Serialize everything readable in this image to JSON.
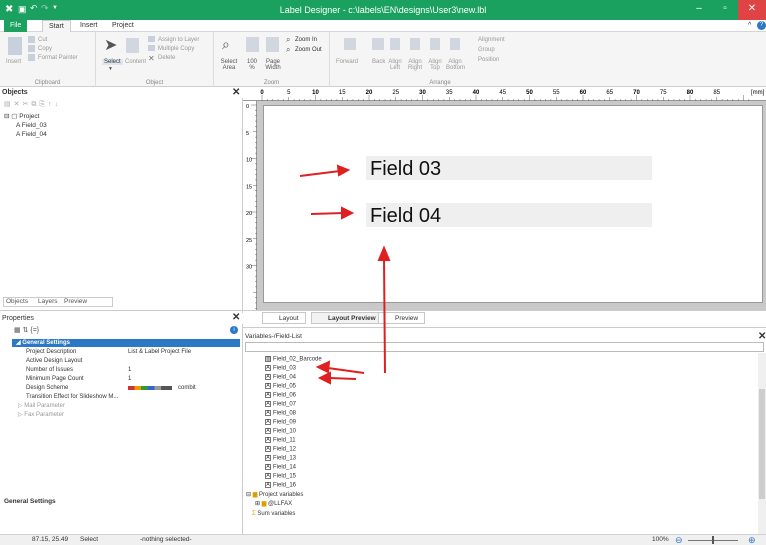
{
  "window": {
    "title": "Label Designer - c:\\labels\\EN\\designs\\User3\\new.lbl"
  },
  "tabs": [
    {
      "label": "File"
    },
    {
      "label": "Start"
    },
    {
      "label": "Insert"
    },
    {
      "label": "Project"
    }
  ],
  "ribbon": {
    "clipboard": {
      "label": "Clipboard",
      "insert": "Insert",
      "cut": "Cut",
      "copy": "Copy",
      "format_painter": "Format Painter"
    },
    "object": {
      "label": "Object",
      "select": "Select",
      "content": "Content",
      "assign_layer": "Assign to Layer",
      "multiple_copy": "Multiple Copy",
      "delete": "Delete"
    },
    "zoom": {
      "label": "Zoom",
      "select_area": "Select Area",
      "hundred": "100 %",
      "page_width": "Page Width",
      "zoom_in": "Zoom In",
      "zoom_out": "Zoom Out"
    },
    "arrange": {
      "label": "Arrange",
      "forward": "Forward",
      "back": "Back",
      "align_left": "Align Left",
      "align_right": "Align Right",
      "align_top": "Align Top",
      "align_bottom": "Align Bottom",
      "alignment": "Alignment",
      "group": "Group",
      "position": "Position"
    }
  },
  "objects_panel": {
    "title": "Objects",
    "tree": [
      {
        "label": "Project"
      },
      {
        "label": "Field_03"
      },
      {
        "label": "Field_04"
      }
    ],
    "tabs": [
      {
        "label": "Objects"
      },
      {
        "label": "Layers"
      },
      {
        "label": "Preview"
      }
    ]
  },
  "properties_panel": {
    "title": "Properties",
    "section": "General Settings",
    "rows": [
      {
        "name": "Project Description",
        "value": "List & Label Project File"
      },
      {
        "name": "Active Design Layout",
        "value": ""
      },
      {
        "name": "Number of Issues",
        "value": "1"
      },
      {
        "name": "Minimum Page Count",
        "value": "1"
      },
      {
        "name": "Design Scheme",
        "value": "combit"
      },
      {
        "name": "Transition Effect for Slideshow M...",
        "value": ""
      }
    ],
    "groups": [
      {
        "label": "Mail Parameter"
      },
      {
        "label": "Fax Parameter"
      }
    ],
    "footer": "General Settings"
  },
  "ruler": {
    "ticks": [
      "0",
      "5",
      "10",
      "15",
      "20",
      "25",
      "30",
      "35",
      "40",
      "45",
      "50",
      "55",
      "60",
      "65",
      "70",
      "75",
      "80",
      "85"
    ],
    "unit": "[mm]",
    "vticks": [
      "0",
      "5",
      "10",
      "15",
      "20",
      "25",
      "30"
    ]
  },
  "canvas": {
    "fields": [
      {
        "text": "Field  03"
      },
      {
        "text": "Field  04"
      }
    ]
  },
  "view_tabs": [
    {
      "label": "Layout"
    },
    {
      "label": "Layout Preview"
    },
    {
      "label": "Preview"
    }
  ],
  "variables_panel": {
    "title": "Variables-/Field-List",
    "items": [
      {
        "label": "Field_02_Barcode"
      },
      {
        "label": "Field_03"
      },
      {
        "label": "Field_04"
      },
      {
        "label": "Field_05"
      },
      {
        "label": "Field_06"
      },
      {
        "label": "Field_07"
      },
      {
        "label": "Field_08"
      },
      {
        "label": "Field_09"
      },
      {
        "label": "Field_10"
      },
      {
        "label": "Field_11"
      },
      {
        "label": "Field_12"
      },
      {
        "label": "Field_13"
      },
      {
        "label": "Field_14"
      },
      {
        "label": "Field_15"
      },
      {
        "label": "Field_16"
      },
      {
        "label": "Project variables"
      },
      {
        "label": "@LLFAX"
      },
      {
        "label": "Sum variables"
      }
    ]
  },
  "statusbar": {
    "coords": "87.15, 25.49",
    "mode": "Select",
    "selection": "-nothing selected-",
    "zoom": "100%"
  },
  "colors": {
    "titlebar": "#1aa15f",
    "accent": "#2b78c5",
    "arrow": "#e02020"
  }
}
